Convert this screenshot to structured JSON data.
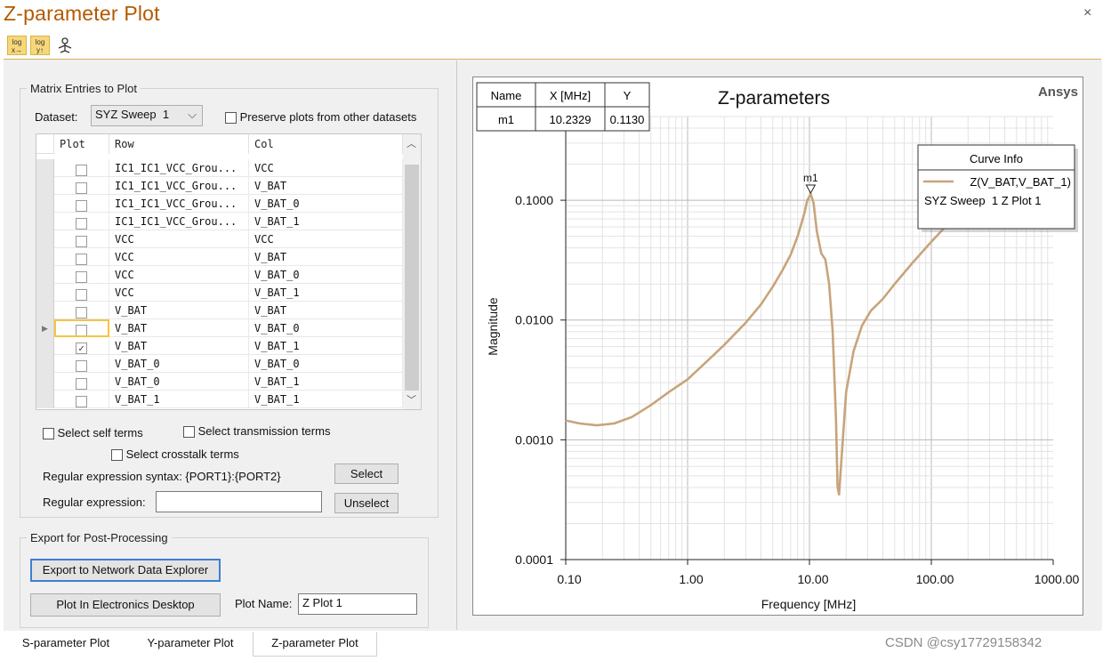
{
  "window": {
    "title": "Z-parameter Plot",
    "close_symbol": "×"
  },
  "toolbar": {
    "log_x_label": "log\nx→",
    "log_y_label": "log\ny↑",
    "icons": [
      "log-x-icon",
      "log-y-icon",
      "reset-view-icon"
    ]
  },
  "matrix": {
    "group_label": "Matrix Entries to Plot",
    "dataset_label": "Dataset:",
    "dataset_value": "SYZ Sweep  1",
    "preserve_label": "Preserve plots from other datasets",
    "headers": [
      "Plot",
      "Row",
      "Col"
    ],
    "rows": [
      {
        "row": "IC1_IC1_VCC_Grou...",
        "col": "VCC",
        "checked": false
      },
      {
        "row": "IC1_IC1_VCC_Grou...",
        "col": "V_BAT",
        "checked": false
      },
      {
        "row": "IC1_IC1_VCC_Grou...",
        "col": "V_BAT_0",
        "checked": false
      },
      {
        "row": "IC1_IC1_VCC_Grou...",
        "col": "V_BAT_1",
        "checked": false
      },
      {
        "row": "VCC",
        "col": "VCC",
        "checked": false
      },
      {
        "row": "VCC",
        "col": "V_BAT",
        "checked": false
      },
      {
        "row": "VCC",
        "col": "V_BAT_0",
        "checked": false
      },
      {
        "row": "VCC",
        "col": "V_BAT_1",
        "checked": false
      },
      {
        "row": "V_BAT",
        "col": "V_BAT",
        "checked": false
      },
      {
        "row": "V_BAT",
        "col": "V_BAT_0",
        "checked": false
      },
      {
        "row": "V_BAT",
        "col": "V_BAT_1",
        "checked": true
      },
      {
        "row": "V_BAT_0",
        "col": "V_BAT_0",
        "checked": false
      },
      {
        "row": "V_BAT_0",
        "col": "V_BAT_1",
        "checked": false
      },
      {
        "row": "V_BAT_1",
        "col": "V_BAT_1",
        "checked": false
      }
    ],
    "current_row_index": 9,
    "select_self_label": "Select self terms",
    "select_transmission_label": "Select transmission terms",
    "select_crosstalk_label": "Select crosstalk terms",
    "regex_syntax_label": "Regular expression syntax: {PORT1}:{PORT2}",
    "regex_label": "Regular expression:",
    "regex_value": "",
    "select_button": "Select",
    "unselect_button": "Unselect"
  },
  "export": {
    "group_label": "Export for Post-Processing",
    "export_button": "Export to Network Data Explorer",
    "plot_in_desktop_button": "Plot In Electronics Desktop",
    "plot_name_label": "Plot Name:",
    "plot_name_value": "Z Plot 1"
  },
  "marker_table": {
    "headers": [
      "Name",
      "X [MHz]",
      "Y"
    ],
    "rows": [
      [
        "m1",
        "10.2329",
        "0.1130"
      ]
    ]
  },
  "curve_info": {
    "title": "Curve Info",
    "entries": [
      {
        "name": "Z(V_BAT,V_BAT_1)",
        "sub": "SYZ Sweep  1 Z Plot 1",
        "color": "#c8a47b"
      }
    ]
  },
  "brand": "Ansys",
  "chart_data": {
    "type": "line",
    "title": "Z-parameters",
    "xlabel": "Frequency [MHz]",
    "ylabel": "Magnitude",
    "x_scale": "log",
    "y_scale": "log",
    "xlim": [
      0.1,
      1000
    ],
    "ylim": [
      0.0001,
      0.5
    ],
    "x_ticks": [
      "0.10",
      "1.00",
      "10.00",
      "100.00",
      "1000.00"
    ],
    "y_ticks": [
      "0.0001",
      "0.0010",
      "0.0100",
      "0.1000"
    ],
    "grid": true,
    "series": [
      {
        "name": "Z(V_BAT,V_BAT_1)",
        "color": "#c8a47b",
        "x": [
          0.1,
          0.13,
          0.18,
          0.25,
          0.35,
          0.5,
          0.7,
          1,
          1.5,
          2,
          3,
          4,
          5,
          6,
          7,
          8,
          9,
          9.6,
          10.23,
          10.8,
          11.5,
          12.5,
          13.5,
          14.5,
          15.5,
          16.5,
          17,
          17.5,
          18.5,
          20,
          23,
          27,
          32,
          40,
          50,
          70,
          100,
          150,
          200,
          300
        ],
        "y": [
          0.00145,
          0.00137,
          0.00132,
          0.00137,
          0.00155,
          0.00195,
          0.0025,
          0.0032,
          0.0047,
          0.0062,
          0.0095,
          0.0135,
          0.019,
          0.026,
          0.035,
          0.05,
          0.075,
          0.1,
          0.113,
          0.095,
          0.055,
          0.036,
          0.032,
          0.02,
          0.008,
          0.0015,
          0.0004,
          0.00035,
          0.0008,
          0.0025,
          0.0055,
          0.009,
          0.012,
          0.015,
          0.02,
          0.03,
          0.045,
          0.07,
          0.1,
          0.17
        ]
      }
    ],
    "markers": [
      {
        "name": "m1",
        "x": 10.2329,
        "y": 0.113
      }
    ]
  },
  "tabs": {
    "items": [
      "S-parameter Plot",
      "Y-parameter Plot",
      "Z-parameter Plot"
    ],
    "active": 2
  },
  "watermark": "CSDN @csy17729158342"
}
